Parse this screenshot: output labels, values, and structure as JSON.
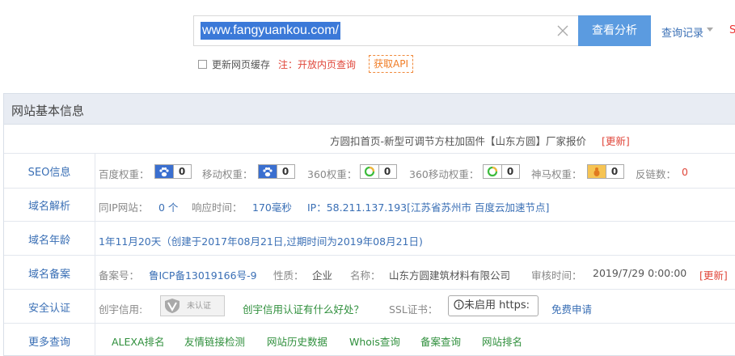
{
  "search": {
    "value": "www.fangyuankou.com/",
    "button": "查看分析",
    "history": "查询记录",
    "edge_text": "S"
  },
  "options": {
    "cache_label": "更新网页缓存",
    "note": "注：开放内页查询",
    "api": "获取API"
  },
  "panel": {
    "title": "网站基本信息",
    "site_title": "方圆扣首页-新型可调节方柱加固件【山东方圆】厂家报价",
    "site_title_update": "[更新]",
    "rows": {
      "seo": {
        "label": "SEO信息",
        "baidu": "百度权重：",
        "baidu_val": "0",
        "mobile": "移动权重：",
        "mobile_val": "0",
        "s360": "360权重：",
        "s360_val": "0",
        "s360m": "360移动权重：",
        "s360m_val": "0",
        "shenma": "神马权重：",
        "shenma_val": "0",
        "backlinks": "反链数：",
        "backlinks_val": "0"
      },
      "dns": {
        "label": "域名解析",
        "same_ip": "同IP网站：",
        "same_ip_val": "0 个",
        "resp": "响应时间：",
        "resp_val": "170毫秒",
        "ip": "IP：58.211.137.193[江苏省苏州市 百度云加速节点]"
      },
      "age": {
        "label": "域名年龄",
        "value": "1年11月20天（创建于2017年08月21日,过期时间为2019年08月21日)"
      },
      "icp": {
        "label": "域名备案",
        "no": "备案号：",
        "no_val": "鲁ICP备13019166号-9",
        "nature": "性质：",
        "nature_val": "企业",
        "name": "名称：",
        "name_val": "山东方圆建筑材料有限公司",
        "audit": "审核时间：",
        "audit_val": "2019/7/29 0:00:00",
        "update": "[更新]"
      },
      "security": {
        "label": "安全认证",
        "credit": "创宇信用:",
        "badge_text": "未认证",
        "credit_link": "创宇信用认证有什么好处？",
        "ssl": "SSL证书：",
        "ssl_val": "未启用 https:",
        "apply": "免费申请"
      },
      "more": {
        "label": "更多查询",
        "links": [
          "ALEXA排名",
          "友情链接检测",
          "网站历史数据",
          "Whois查询",
          "备案查询",
          "网站排名"
        ]
      }
    }
  },
  "colors": {
    "accent": "#5b9be0",
    "link": "#3a6fb5",
    "warn": "#e0463a",
    "green": "#2f8f3c"
  }
}
